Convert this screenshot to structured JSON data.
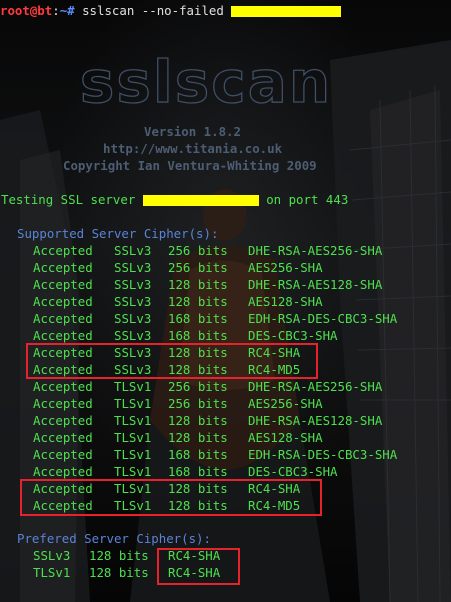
{
  "prompt": {
    "user_host": "root@bt",
    "sep": ":",
    "path": "~",
    "symbol": "#",
    "command": "sslscan --no-failed"
  },
  "banner": {
    "logo_text": "sslscan",
    "version": "Version 1.8.2",
    "url": "http://www.titania.co.uk",
    "copyright": "Copyright Ian Ventura-Whiting 2009"
  },
  "testing": {
    "prefix": "Testing SSL server",
    "suffix": "on port 443"
  },
  "supported": {
    "heading": "Supported Server Cipher(s):",
    "rows": [
      {
        "status": "Accepted",
        "proto": "SSLv3",
        "bits": "256 bits",
        "cipher": "DHE-RSA-AES256-SHA"
      },
      {
        "status": "Accepted",
        "proto": "SSLv3",
        "bits": "256 bits",
        "cipher": "AES256-SHA"
      },
      {
        "status": "Accepted",
        "proto": "SSLv3",
        "bits": "128 bits",
        "cipher": "DHE-RSA-AES128-SHA"
      },
      {
        "status": "Accepted",
        "proto": "SSLv3",
        "bits": "128 bits",
        "cipher": "AES128-SHA"
      },
      {
        "status": "Accepted",
        "proto": "SSLv3",
        "bits": "168 bits",
        "cipher": "EDH-RSA-DES-CBC3-SHA"
      },
      {
        "status": "Accepted",
        "proto": "SSLv3",
        "bits": "168 bits",
        "cipher": "DES-CBC3-SHA"
      },
      {
        "status": "Accepted",
        "proto": "SSLv3",
        "bits": "128 bits",
        "cipher": "RC4-SHA"
      },
      {
        "status": "Accepted",
        "proto": "SSLv3",
        "bits": "128 bits",
        "cipher": "RC4-MD5"
      },
      {
        "status": "Accepted",
        "proto": "TLSv1",
        "bits": "256 bits",
        "cipher": "DHE-RSA-AES256-SHA"
      },
      {
        "status": "Accepted",
        "proto": "TLSv1",
        "bits": "256 bits",
        "cipher": "AES256-SHA"
      },
      {
        "status": "Accepted",
        "proto": "TLSv1",
        "bits": "128 bits",
        "cipher": "DHE-RSA-AES128-SHA"
      },
      {
        "status": "Accepted",
        "proto": "TLSv1",
        "bits": "128 bits",
        "cipher": "AES128-SHA"
      },
      {
        "status": "Accepted",
        "proto": "TLSv1",
        "bits": "168 bits",
        "cipher": "EDH-RSA-DES-CBC3-SHA"
      },
      {
        "status": "Accepted",
        "proto": "TLSv1",
        "bits": "168 bits",
        "cipher": "DES-CBC3-SHA"
      },
      {
        "status": "Accepted",
        "proto": "TLSv1",
        "bits": "128 bits",
        "cipher": "RC4-SHA"
      },
      {
        "status": "Accepted",
        "proto": "TLSv1",
        "bits": "128 bits",
        "cipher": "RC4-MD5"
      }
    ]
  },
  "preferred": {
    "heading": "Prefered Server Cipher(s):",
    "rows": [
      {
        "proto": "SSLv3",
        "bits": "128 bits",
        "cipher": "RC4-SHA"
      },
      {
        "proto": "TLSv1",
        "bits": "128 bits",
        "cipher": "RC4-SHA"
      }
    ]
  },
  "colors": {
    "background": "#000000",
    "prompt_user": "#ff3b3b",
    "prompt_path": "#5d8cff",
    "heading_blue": "#5b83d8",
    "accepted_green": "#4fe04f",
    "redaction_yellow": "#ffff00",
    "highlight_red": "#e8222c"
  }
}
